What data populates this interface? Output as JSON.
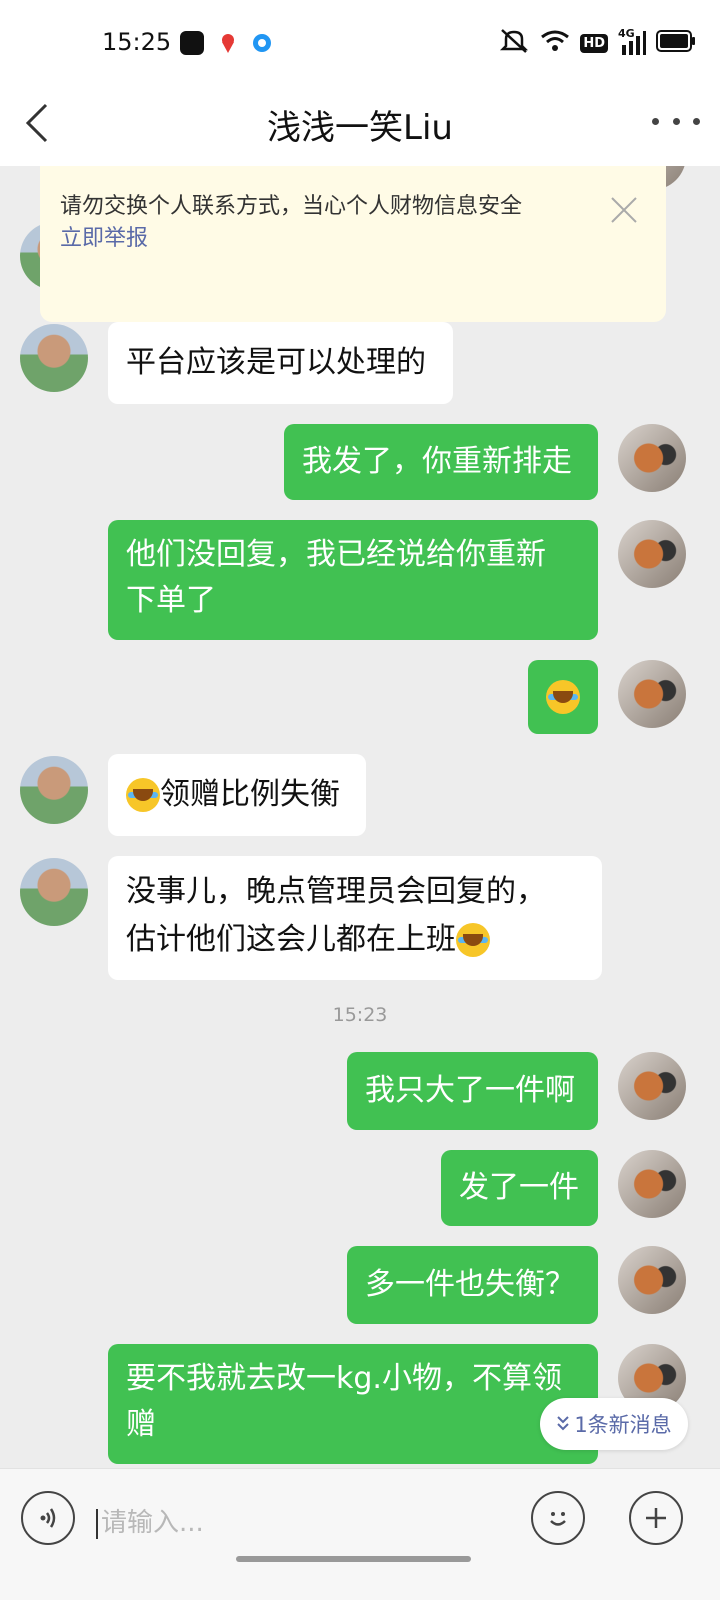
{
  "status_bar": {
    "time": "15:25",
    "network": "4G",
    "hd": "HD"
  },
  "header": {
    "title": "浅浅一笑Liu"
  },
  "banner": {
    "text": "请勿交换个人联系方式，当心个人财物信息安全",
    "link": "立即举报"
  },
  "messages": [
    {
      "side": "them",
      "text": "平台应该是可以处理的"
    },
    {
      "side": "me",
      "text": "我发了，你重新排走"
    },
    {
      "side": "me",
      "line1": "他们没回复，我已经说给你重新",
      "line2": "下单了"
    },
    {
      "side": "me",
      "emoji": "cry-laugh-emoji"
    },
    {
      "side": "them",
      "text": "领赠比例失衡",
      "emoji": "cry-laugh-emoji"
    },
    {
      "side": "them",
      "line1": "没事儿，晚点管理员会回复的，",
      "line2": "估计他们这会儿都在上班",
      "emoji": "cry-laugh-emoji"
    },
    {
      "side": "me",
      "text": "我只大了一件啊"
    },
    {
      "side": "me",
      "text": "发了一件"
    },
    {
      "side": "me",
      "text": "多一件也失衡？"
    },
    {
      "side": "me",
      "line1": "要不我就去改一kg.小物，不算领",
      "line2": "赠"
    }
  ],
  "timestamp": "15:23",
  "new_message_pill": {
    "label": "1条新消息"
  },
  "input": {
    "placeholder": "请输入..."
  },
  "colors": {
    "green_bubble": "#41c152",
    "link": "#5a6aa8",
    "banner_bg": "#fffbe6"
  }
}
